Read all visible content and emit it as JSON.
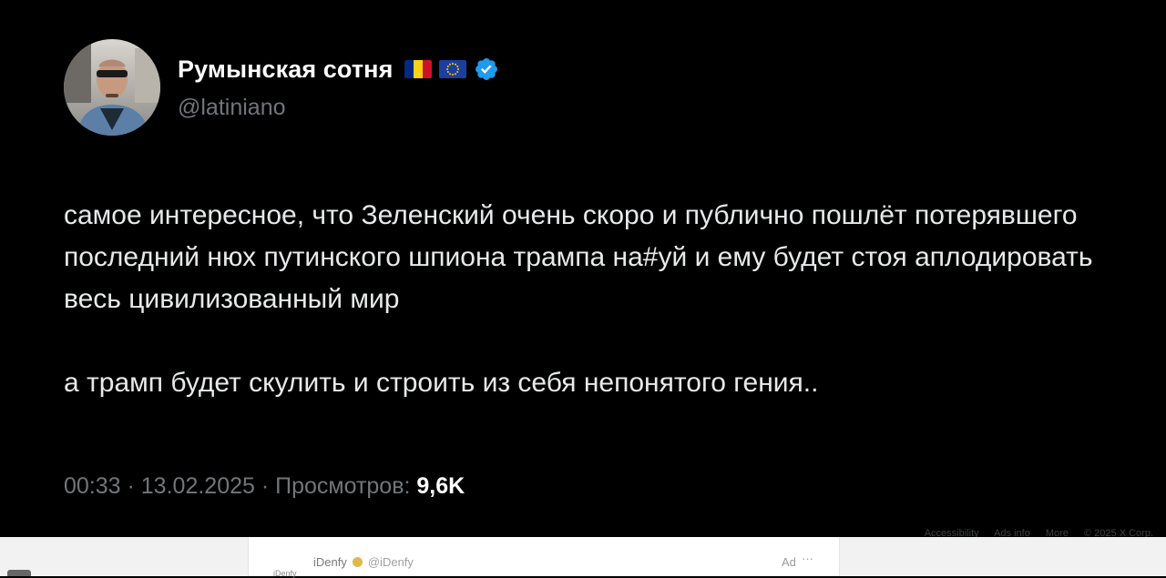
{
  "tweet": {
    "display_name": "Румынская сотня",
    "handle": "@latiniano",
    "flags": [
      "romania-flag",
      "eu-flag"
    ],
    "verified": true,
    "paragraphs": [
      "самое интересное, что Зеленский очень скоро и публично пошлёт потерявшего последний нюх путинского шпиона трампа на#уй и ему будет стоя аплодировать весь цивилизованный мир",
      "а трамп будет скулить и строить из себя непонятого гения.."
    ],
    "time": "00:33",
    "date": "13.02.2025",
    "views_label": "Просмотров:",
    "views_count": "9,6K",
    "separator": " · "
  },
  "colors": {
    "background": "#000000",
    "text": "#e7e9ea",
    "muted": "#71767b",
    "verified_badge": "#1d9bf0",
    "romania_flag": [
      "#002b7f",
      "#fcd116",
      "#ce1126"
    ],
    "eu_flag": "#1c3f9e"
  },
  "footer": {
    "links": [
      "Accessibility",
      "Ads info",
      "More",
      "© 2025 X Corp."
    ]
  },
  "ad_card": {
    "logo_text": "iDenfy",
    "name": "iDenfy",
    "handle": "@iDenfy",
    "ad_label": "Ad",
    "more": "···"
  }
}
